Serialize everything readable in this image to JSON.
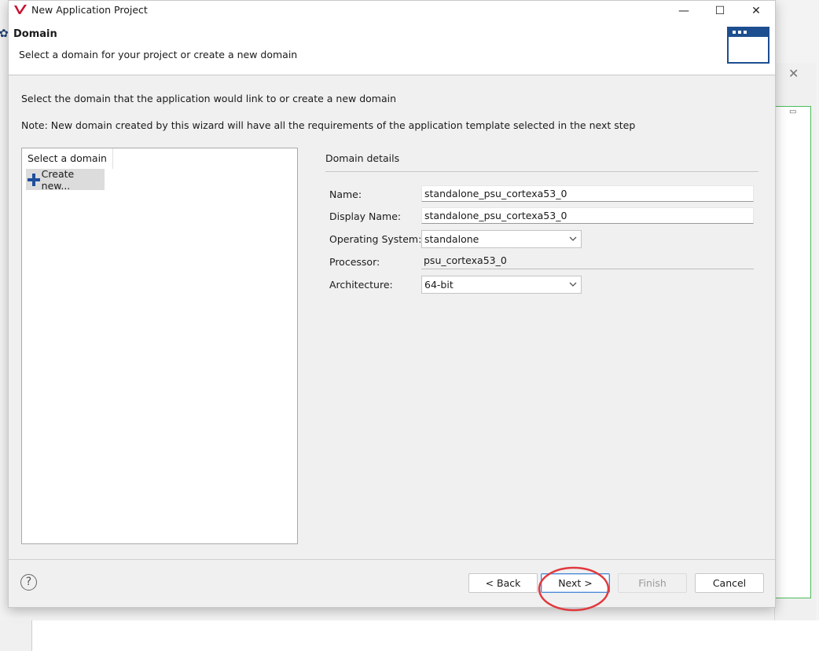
{
  "window": {
    "title": "New Application Project",
    "minimize_symbol": "—",
    "maximize_symbol": "☐",
    "close_symbol": "✕"
  },
  "header": {
    "title": "Domain",
    "subtitle": "Select a domain for your project or create a new domain"
  },
  "body": {
    "intro": "Select the domain that the application would link to or create a new domain",
    "note": "Note: New domain created by this wizard will have all the requirements of the application template selected in the next step"
  },
  "domain_list": {
    "header": "Select a domain",
    "items": [
      {
        "label": "Create new...",
        "icon": "plus-icon",
        "selected": true
      }
    ]
  },
  "details": {
    "title": "Domain details",
    "name_label": "Name:",
    "name_value": "standalone_psu_cortexa53_0",
    "display_name_label": "Display Name:",
    "display_name_value": "standalone_psu_cortexa53_0",
    "os_label": "Operating System:",
    "os_value": "standalone",
    "processor_label": "Processor:",
    "processor_value": "psu_cortexa53_0",
    "arch_label": "Architecture:",
    "arch_value": "64-bit"
  },
  "footer": {
    "help_symbol": "?",
    "back_label": "< Back",
    "next_label": "Next >",
    "finish_label": "Finish",
    "cancel_label": "Cancel"
  },
  "annotations": {
    "highlight_color": "#e0393e",
    "highlight_target": "next-button"
  },
  "colors": {
    "accent": "#1f4f9c",
    "brand": "#c8102e",
    "default_button_border": "#4a8ad6"
  }
}
